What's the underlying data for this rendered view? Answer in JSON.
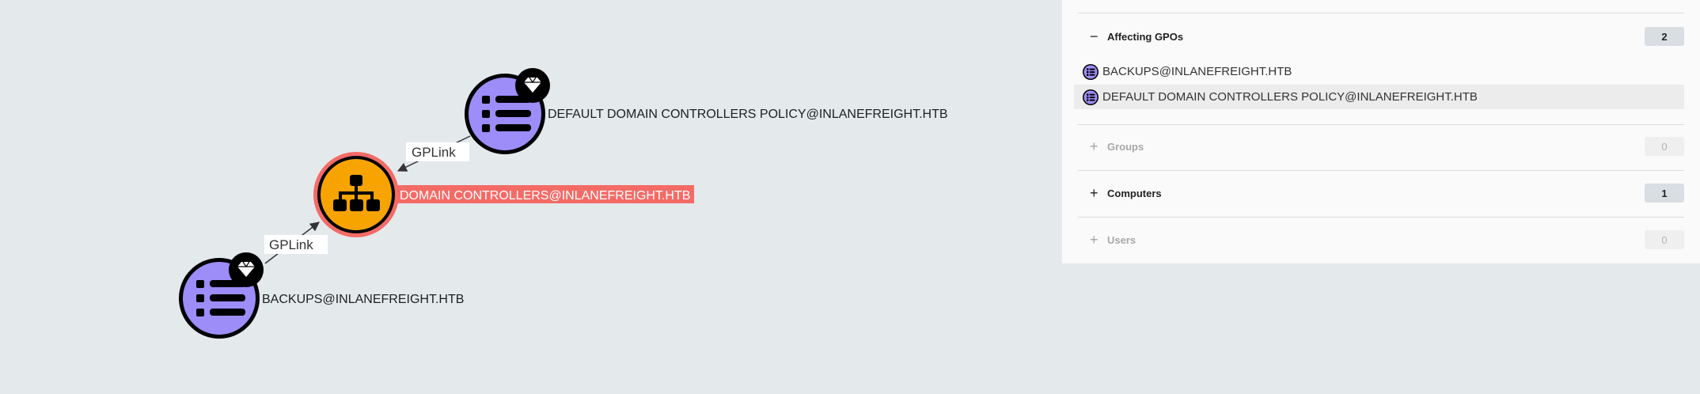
{
  "graph": {
    "nodes": {
      "default_dc_policy": {
        "label": "DEFAULT DOMAIN CONTROLLERS POLICY@INLANEFREIGHT.HTB",
        "icon": "gpo-list-icon",
        "badge": "gem-icon",
        "color": "#9c8df8"
      },
      "domain_controllers": {
        "label": "DOMAIN CONTROLLERS@INLANEFREIGHT.HTB",
        "icon": "ou-hierarchy-icon",
        "color": "#f8a400",
        "highlight_color": "#f46b66"
      },
      "backups": {
        "label": "BACKUPS@INLANEFREIGHT.HTB",
        "icon": "gpo-list-icon",
        "badge": "gem-icon",
        "color": "#9c8df8"
      }
    },
    "edges": [
      {
        "from": "default_dc_policy",
        "to": "domain_controllers",
        "label": "GPLink"
      },
      {
        "from": "backups",
        "to": "domain_controllers",
        "label": "GPLink"
      }
    ]
  },
  "panel": {
    "affecting_gpos": {
      "toggle": "−",
      "title": "Affecting GPOs",
      "count": "2",
      "items": [
        "BACKUPS@INLANEFREIGHT.HTB",
        "DEFAULT DOMAIN CONTROLLERS POLICY@INLANEFREIGHT.HTB"
      ]
    },
    "groups": {
      "toggle": "+",
      "title": "Groups",
      "count": "0"
    },
    "computers": {
      "toggle": "+",
      "title": "Computers",
      "count": "1"
    },
    "users": {
      "toggle": "+",
      "title": "Users",
      "count": "0"
    }
  }
}
